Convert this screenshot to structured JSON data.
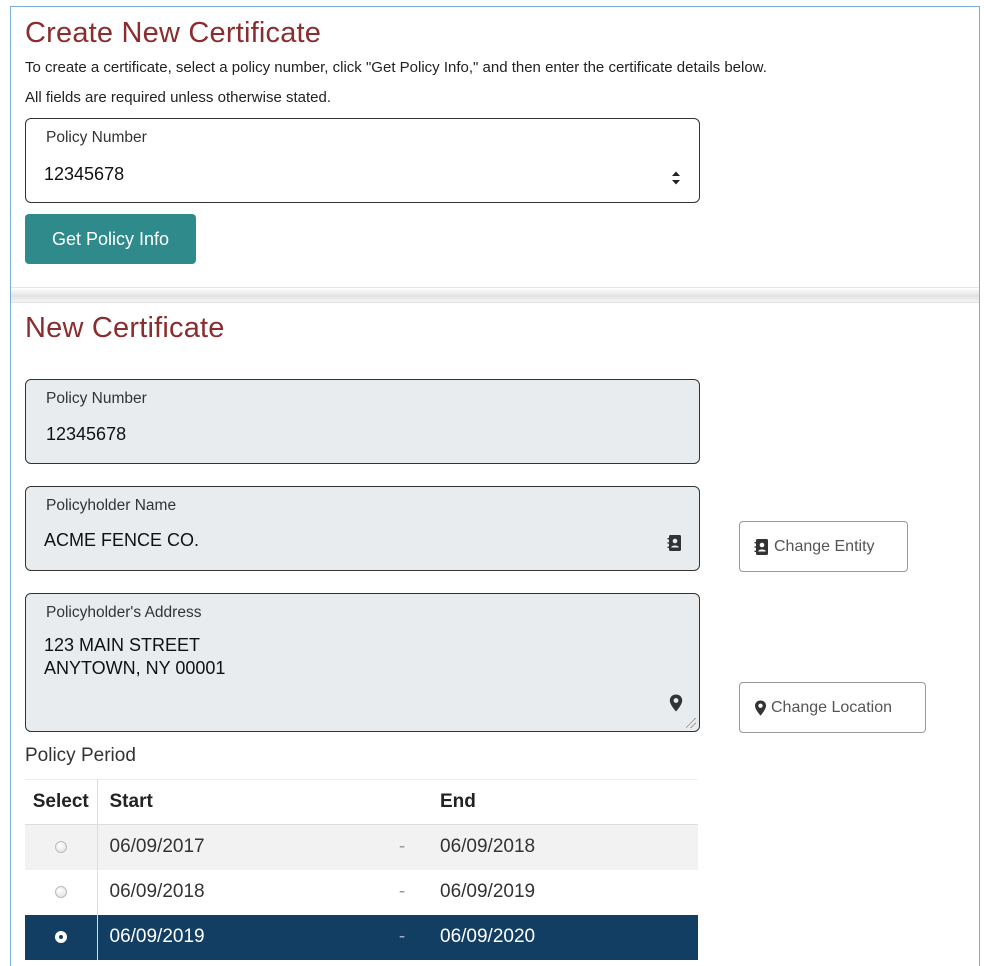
{
  "create_section": {
    "title": "Create New Certificate",
    "instructions": "To create a certificate, select a policy number, click \"Get Policy Info,\" and then enter the certificate details below.",
    "required_note": "All fields are required unless otherwise stated.",
    "policy_select": {
      "label": "Policy Number",
      "value": "12345678"
    },
    "get_policy_button": "Get Policy Info"
  },
  "new_certificate": {
    "title": "New Certificate",
    "policy_number": {
      "label": "Policy Number",
      "value": "12345678"
    },
    "policyholder_name": {
      "label": "Policyholder Name",
      "value": "ACME FENCE CO.",
      "icon": "address-book-icon"
    },
    "change_entity_button": "Change Entity",
    "policyholder_address": {
      "label": "Policyholder's Address",
      "line1": "123 MAIN STREET",
      "line2": "ANYTOWN, NY 00001",
      "icon": "map-marker-icon"
    },
    "change_location_button": "Change Location",
    "policy_period": {
      "label": "Policy Period",
      "columns": {
        "select": "Select",
        "start": "Start",
        "end": "End"
      },
      "separator": "-",
      "rows": [
        {
          "start": "06/09/2017",
          "end": "06/09/2018",
          "selected": false
        },
        {
          "start": "06/09/2018",
          "end": "06/09/2019",
          "selected": false
        },
        {
          "start": "06/09/2019",
          "end": "06/09/2020",
          "selected": true
        }
      ]
    }
  },
  "colors": {
    "heading": "#8b2d2e",
    "primary_button": "#2f8a8c",
    "selected_row": "#123e63",
    "readonly_field": "#e9ecef"
  }
}
